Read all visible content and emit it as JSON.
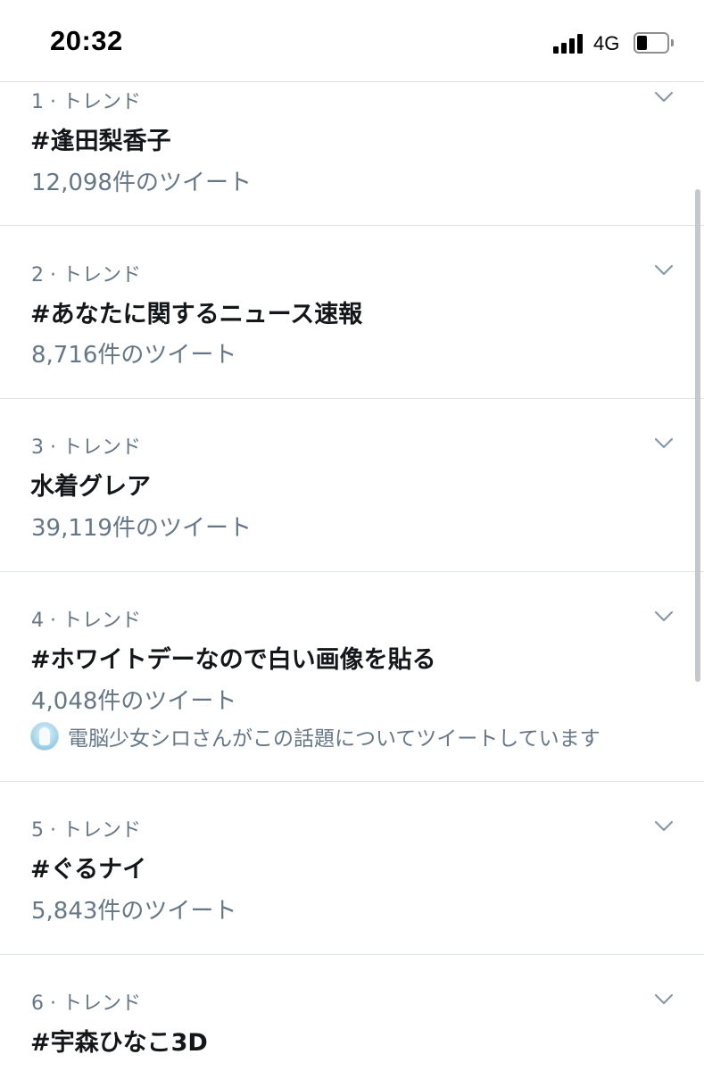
{
  "status_bar": {
    "time": "20:32",
    "network": "4G",
    "battery_level": 0.35
  },
  "trends": [
    {
      "rank": "1 · トレンド",
      "name": "#逢田梨香子",
      "count": "12,098件のツイート"
    },
    {
      "rank": "2 · トレンド",
      "name": "#あなたに関するニュース速報",
      "count": "8,716件のツイート"
    },
    {
      "rank": "3 · トレンド",
      "name": "水着グレア",
      "count": "39,119件のツイート"
    },
    {
      "rank": "4 · トレンド",
      "name": "#ホワイトデーなので白い画像を貼る",
      "count": "4,048件のツイート",
      "context": "電脳少女シロさんがこの話題についてツイートしています"
    },
    {
      "rank": "5 · トレンド",
      "name": "#ぐるナイ",
      "count": "5,843件のツイート"
    },
    {
      "rank": "6 · トレンド",
      "name": "#宇森ひなこ3D",
      "count": ""
    }
  ],
  "colors": {
    "primary_text": "#14171a",
    "secondary_text": "#657786",
    "divider": "#dfe3e6"
  },
  "icons": {
    "expand": "chevron-down-icon",
    "signal": "cellular-signal-icon",
    "battery": "battery-icon"
  }
}
